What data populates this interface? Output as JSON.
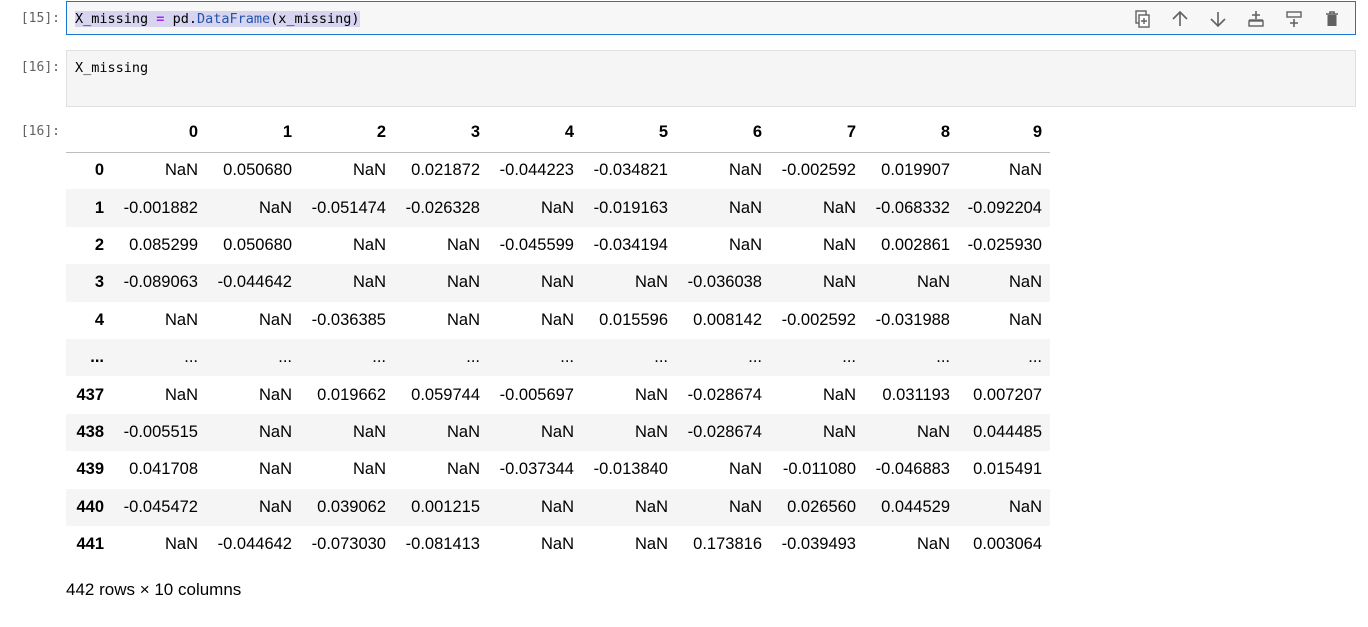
{
  "cells": [
    {
      "prompt": "[15]:",
      "code_parts": [
        "X_missing",
        " ",
        "=",
        " pd.",
        "DataFrame",
        "(x_missing)"
      ]
    },
    {
      "prompt": "[16]:",
      "code": "X_missing"
    }
  ],
  "output_prompt": "[16]:",
  "toolbar": {
    "icons": [
      "duplicate-icon",
      "move-up-icon",
      "move-down-icon",
      "insert-below-icon",
      "insert-above-icon",
      "delete-icon"
    ]
  },
  "table": {
    "columns": [
      "",
      "0",
      "1",
      "2",
      "3",
      "4",
      "5",
      "6",
      "7",
      "8",
      "9"
    ],
    "rows": [
      {
        "index": "0",
        "values": [
          "NaN",
          "0.050680",
          "NaN",
          "0.021872",
          "-0.044223",
          "-0.034821",
          "NaN",
          "-0.002592",
          "0.019907",
          "NaN"
        ]
      },
      {
        "index": "1",
        "values": [
          "-0.001882",
          "NaN",
          "-0.051474",
          "-0.026328",
          "NaN",
          "-0.019163",
          "NaN",
          "NaN",
          "-0.068332",
          "-0.092204"
        ]
      },
      {
        "index": "2",
        "values": [
          "0.085299",
          "0.050680",
          "NaN",
          "NaN",
          "-0.045599",
          "-0.034194",
          "NaN",
          "NaN",
          "0.002861",
          "-0.025930"
        ]
      },
      {
        "index": "3",
        "values": [
          "-0.089063",
          "-0.044642",
          "NaN",
          "NaN",
          "NaN",
          "NaN",
          "-0.036038",
          "NaN",
          "NaN",
          "NaN"
        ]
      },
      {
        "index": "4",
        "values": [
          "NaN",
          "NaN",
          "-0.036385",
          "NaN",
          "NaN",
          "0.015596",
          "0.008142",
          "-0.002592",
          "-0.031988",
          "NaN"
        ]
      },
      {
        "index": "...",
        "values": [
          "...",
          "...",
          "...",
          "...",
          "...",
          "...",
          "...",
          "...",
          "...",
          "..."
        ]
      },
      {
        "index": "437",
        "values": [
          "NaN",
          "NaN",
          "0.019662",
          "0.059744",
          "-0.005697",
          "NaN",
          "-0.028674",
          "NaN",
          "0.031193",
          "0.007207"
        ]
      },
      {
        "index": "438",
        "values": [
          "-0.005515",
          "NaN",
          "NaN",
          "NaN",
          "NaN",
          "NaN",
          "-0.028674",
          "NaN",
          "NaN",
          "0.044485"
        ]
      },
      {
        "index": "439",
        "values": [
          "0.041708",
          "NaN",
          "NaN",
          "NaN",
          "-0.037344",
          "-0.013840",
          "NaN",
          "-0.011080",
          "-0.046883",
          "0.015491"
        ]
      },
      {
        "index": "440",
        "values": [
          "-0.045472",
          "NaN",
          "0.039062",
          "0.001215",
          "NaN",
          "NaN",
          "NaN",
          "0.026560",
          "0.044529",
          "NaN"
        ]
      },
      {
        "index": "441",
        "values": [
          "NaN",
          "-0.044642",
          "-0.073030",
          "-0.081413",
          "NaN",
          "NaN",
          "0.173816",
          "-0.039493",
          "NaN",
          "0.003064"
        ]
      }
    ]
  },
  "footer": "442 rows × 10 columns"
}
